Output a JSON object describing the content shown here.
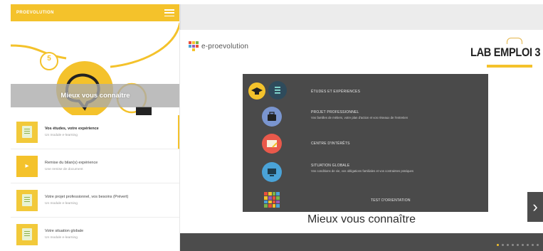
{
  "sidebar": {
    "brand": "PROEVOLUTION",
    "hero_number": "5",
    "hero_title": "Mieux vous connaître",
    "modules": [
      {
        "title": "Vos études, votre expérience",
        "subtitle": "Un module e-learning",
        "icon": "document-icon",
        "active": true
      },
      {
        "title": "Remise du bilan(s) expérience",
        "subtitle": "Une remise de document",
        "icon": "arrow-right-icon",
        "active": false
      },
      {
        "title": "Votre projet professionnel, vos besoins (Prévert)",
        "subtitle": "Un module e-learning",
        "icon": "document-icon",
        "active": false
      },
      {
        "title": "Votre situation globale",
        "subtitle": "Un module e-learning",
        "icon": "document-icon",
        "active": false
      }
    ]
  },
  "slide": {
    "logo_text": "e-proevolution",
    "lab_title": "LAB EMPLOI 3",
    "menu": [
      {
        "label": "ÉTUDES ET EXPÉRIENCES",
        "sub": "",
        "icon": "graduation-cap-icon",
        "color": "#f4c22b"
      },
      {
        "label": "PROJET PROFESSIONNEL",
        "sub": "Vos familles de métiers, votre plan d'action et vos réseaux de l'entretien",
        "icon": "briefcase-icon",
        "color": "#7a95cf"
      },
      {
        "label": "CENTRE D'INTÉRÊTS",
        "sub": "",
        "icon": "notebook-icon",
        "color": "#e9594b"
      },
      {
        "label": "SITUATION GLOBALE",
        "sub": "Vos conditions de vie, vos obligations familiales et vos contraintes pratiques",
        "icon": "computer-icon",
        "color": "#4aa3d8"
      },
      {
        "label": "TEST D'ORIENTATION",
        "sub": "",
        "icon": "mosaic-icon",
        "color": "#f4c22b"
      }
    ],
    "caption": "Mieux vous connaître"
  },
  "pager": {
    "total": 9,
    "current": 1
  },
  "colors": {
    "accent": "#f4c22b",
    "panel": "#4a4a4a",
    "bar": "#4c4c4c"
  }
}
